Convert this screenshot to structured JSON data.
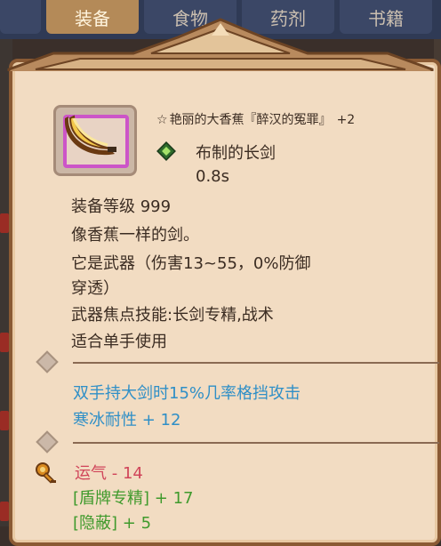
{
  "tabs": [
    {
      "label": "装备",
      "active": true
    },
    {
      "label": "食物",
      "active": false
    },
    {
      "label": "药剂",
      "active": false
    },
    {
      "label": "书籍",
      "active": false
    }
  ],
  "item": {
    "title_star": "☆",
    "title": "艳丽的大香蕉『醉汉的冤罪』",
    "plus": "+2",
    "type": "布制的长剑",
    "speed": "0.8s",
    "level": "装备等级 999",
    "description": "像香蕉一样的剑。",
    "weapon_line1": "它是武器（伤害13~55，0%防御",
    "weapon_line2": "穿透）",
    "focus_skill": "武器焦点技能:长剑专精,战术",
    "hand_usage": "适合单手使用"
  },
  "effects": [
    {
      "text": "双手持大剑时15%几率格挡攻击",
      "color": "#2f8fc7"
    },
    {
      "text": "寒冰耐性 + 12",
      "color": "#2f8fc7"
    }
  ],
  "stats": [
    {
      "text": "运气 - 14",
      "color": "#d0455a"
    },
    {
      "text": "[盾牌专精] + 17",
      "color": "#3f9a2c"
    },
    {
      "text": "[隐蔽] + 5",
      "color": "#3f9a2c"
    }
  ],
  "colors": {
    "panel": "#f2dcc2",
    "border": "#8a5a34",
    "rarity_frame": "#cc55c8",
    "blue_text": "#2f8fc7",
    "red_text": "#d0455a",
    "green_text": "#3f9a2c"
  },
  "icons": {
    "item_icon": "banana-sword-icon",
    "type_icon": "green-gem-icon",
    "divider_icon": "diamond-icon",
    "stat_icon": "luck-key-icon"
  }
}
